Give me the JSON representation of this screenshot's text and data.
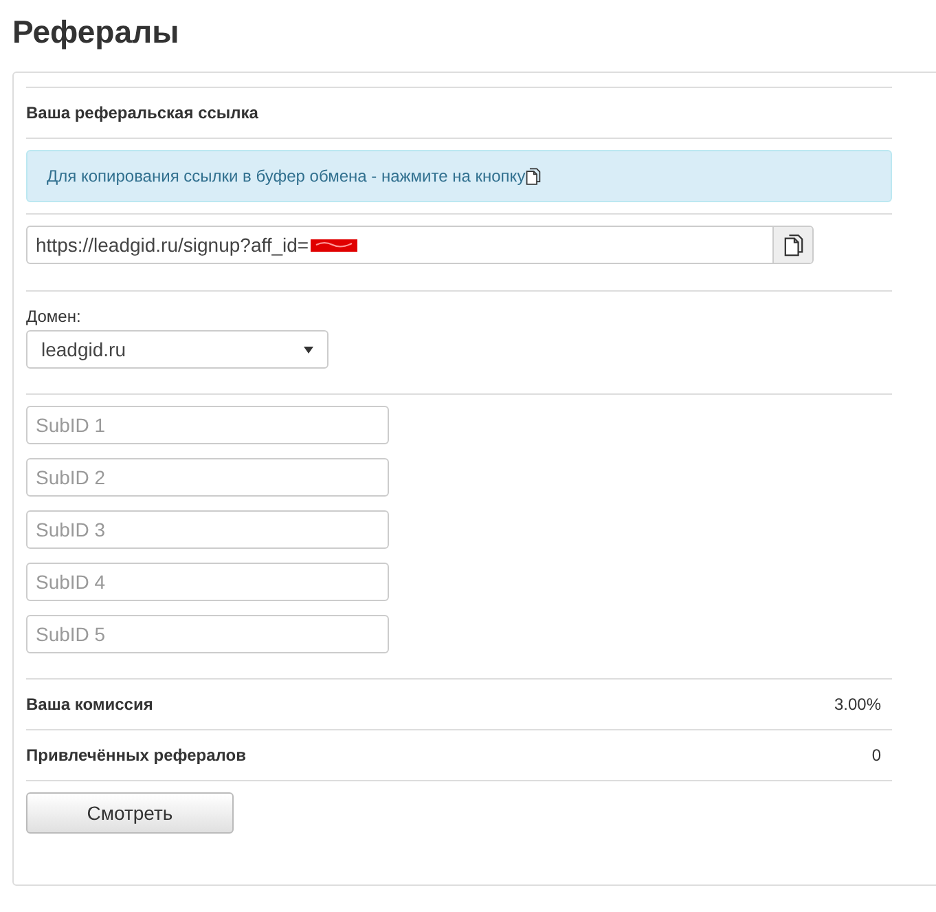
{
  "page_title": "Рефералы",
  "referral_link": {
    "heading": "Ваша реферальская ссылка",
    "hint": "Для копирования ссылки в буфер обмена - нажмите на кнопку",
    "url": "https://leadgid.ru/signup?aff_id=",
    "redacted": true
  },
  "domain": {
    "label": "Домен:",
    "value": "leadgid.ru"
  },
  "subids": [
    {
      "placeholder": "SubID 1"
    },
    {
      "placeholder": "SubID 2"
    },
    {
      "placeholder": "SubID 3"
    },
    {
      "placeholder": "SubID 4"
    },
    {
      "placeholder": "SubID 5"
    }
  ],
  "stats": [
    {
      "label": "Ваша комиссия",
      "value": "3.00%"
    },
    {
      "label": "Привлечённых рефералов",
      "value": "0"
    }
  ],
  "view_button": "Смотреть"
}
